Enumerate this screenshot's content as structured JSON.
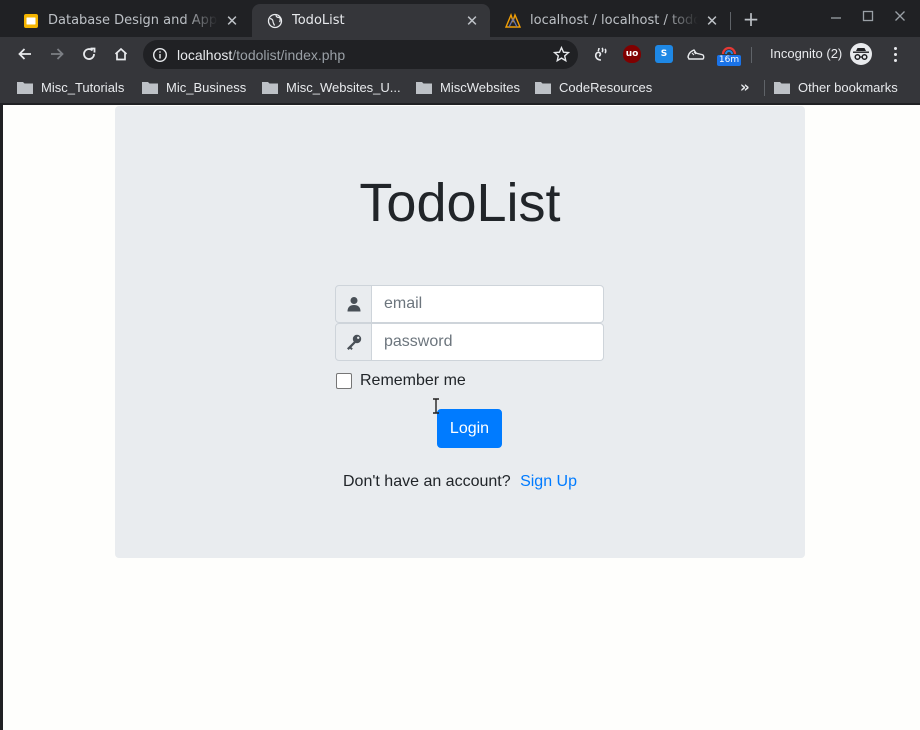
{
  "browser": {
    "tabs": [
      {
        "title": "Database Design and Applicat",
        "active": false
      },
      {
        "title": "TodoList",
        "active": true
      },
      {
        "title": "localhost / localhost / todoli",
        "active": false
      }
    ],
    "url_host": "localhost",
    "url_path": "/todolist/index.php",
    "incognito_label": "Incognito (2)",
    "ext_badge": "16m",
    "ext_ub": "uo",
    "ext_s": "S",
    "bookmarks": [
      "Misc_Tutorials",
      "Mic_Business",
      "Misc_Websites_U...",
      "MiscWebsites",
      "CodeResources"
    ],
    "other_bookmarks": "Other bookmarks",
    "more": "»"
  },
  "page": {
    "title": "TodoList",
    "email_placeholder": "email",
    "password_placeholder": "password",
    "remember_label": "Remember me",
    "login_label": "Login",
    "signup_prompt": "Don't have an account?",
    "signup_link": "Sign Up"
  },
  "colors": {
    "primary": "#007bff",
    "jumbotron": "#e9ecef",
    "chrome_dark": "#202124",
    "chrome_toolbar": "#35363a"
  }
}
